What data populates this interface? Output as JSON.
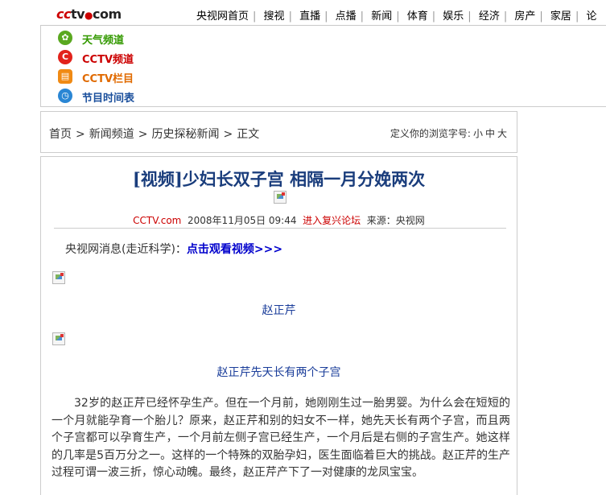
{
  "header": {
    "logo_text": "cctv.com",
    "nav": [
      "央视网首页",
      "搜视",
      "直播",
      "点播",
      "新闻",
      "体育",
      "娱乐",
      "经济",
      "房产",
      "家居",
      "论"
    ]
  },
  "channels": [
    {
      "label": "天气频道",
      "icon": "weather-icon",
      "color": "#339900",
      "icon_color": "#5aa820"
    },
    {
      "label": "CCTV频道",
      "icon": "cctv-channel-icon",
      "color": "#cc0000",
      "icon_color": "#e2221b"
    },
    {
      "label": "CCTV栏目",
      "icon": "cctv-column-icon",
      "color": "#e06a00",
      "icon_color": "#f08a14"
    },
    {
      "label": "节目时间表",
      "icon": "schedule-icon",
      "color": "#1a4f9c",
      "icon_color": "#2a86d4"
    }
  ],
  "breadcrumb": {
    "items": [
      "首页",
      "新闻频道",
      "历史探秘新闻",
      "正文"
    ],
    "separator": ">"
  },
  "fontsize": {
    "label": "定义你的浏览字号:",
    "options": [
      "小",
      "中",
      "大"
    ]
  },
  "article": {
    "title": "[视频]少妇长双子宫 相隔一月分娩两次",
    "source_site": "CCTV.com",
    "datetime": "2008年11月05日 09:44",
    "forum_link": "进入复兴论坛",
    "source": "来源：央视网",
    "news_prefix": "央视网消息(走近科学)：",
    "video_link": "点击观看视频>>>",
    "caption1": "赵正芹",
    "caption2": "赵正芹先天长有两个子宫",
    "body": "32岁的赵正芹已经怀孕生产。但在一个月前，她刚刚生过一胎男婴。为什么会在短短的一个月就能孕育一个胎儿？原来，赵正芹和别的妇女不一样，她先天长有两个子宫，而且两个子宫都可以孕育生产，一个月前左侧子宫已经生产，一个月后是右侧的子宫生产。她这样的几率是5百万分之一。这样的一个特殊的双胎孕妇，医生面临着巨大的挑战。赵正芹的生产过程可谓一波三折，惊心动魄。最终，赵正芹产下了一对健康的龙凤宝宝。"
  },
  "colors": {
    "title": "#1a3d7c",
    "link": "#0000cc",
    "red": "#cc0000",
    "border": "#cccccc"
  }
}
